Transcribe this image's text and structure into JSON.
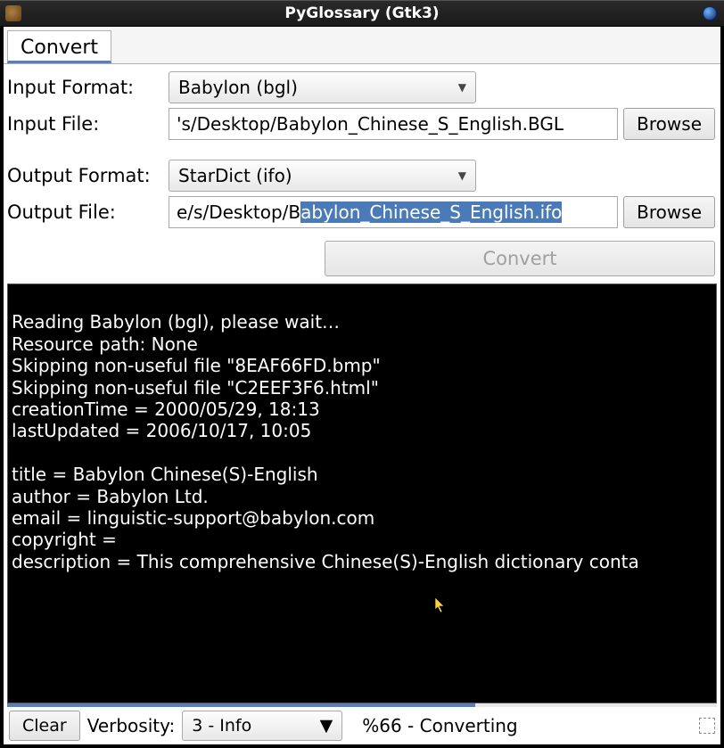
{
  "window": {
    "title": "PyGlossary (Gtk3)"
  },
  "tabs": {
    "convert": "Convert"
  },
  "form": {
    "input_format_label": "Input Format:",
    "input_format_value": "Babylon (bgl)",
    "input_file_label": "Input File:",
    "input_file_value": "'s/Desktop/Babylon_Chinese_S_English.BGL",
    "output_format_label": "Output Format:",
    "output_format_value": "StarDict (ifo)",
    "output_file_label": "Output File:",
    "output_file_prefix": "e/s/Desktop/B",
    "output_file_selected": "abylon_Chinese_S_English.ifo",
    "browse_label": "Browse",
    "convert_label": "Convert"
  },
  "console_text": "\nReading Babylon (bgl), please wait…\nResource path: None\nSkipping non-useful file \"8EAF66FD.bmp\"\nSkipping non-useful file \"C2EEF3F6.html\"\ncreationTime = 2000/05/29, 18:13\nlastUpdated = 2006/10/17, 10:05\n\ntitle = Babylon Chinese(S)-English\nauthor = Babylon Ltd.\nemail = linguistic-support@babylon.com\ncopyright = \ndescription = This comprehensive Chinese(S)-English dictionary conta",
  "status": {
    "clear_label": "Clear",
    "verbosity_label": "Verbosity:",
    "verbosity_value": "3 - Info",
    "progress_percent": 66,
    "progress_text": "%66 - Converting"
  }
}
